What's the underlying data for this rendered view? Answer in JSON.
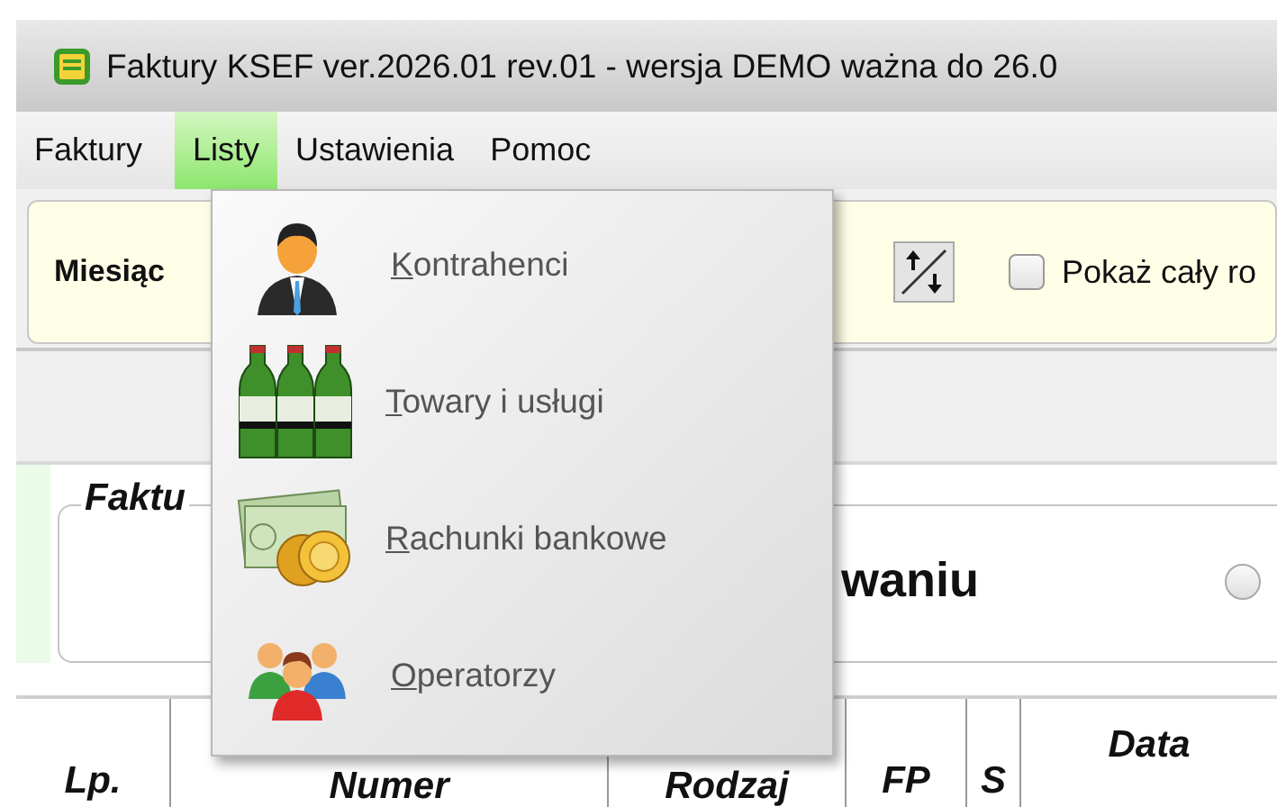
{
  "window": {
    "title": "Faktury KSEF ver.2026.01 rev.01 - wersja DEMO ważna do 26.0"
  },
  "menu_bar": [
    {
      "label": "Faktury",
      "selected": false
    },
    {
      "label": "Listy",
      "selected": true
    },
    {
      "label": "Ustawienia",
      "selected": false
    },
    {
      "label": "Pomoc",
      "selected": false
    }
  ],
  "dropdown": {
    "items": [
      {
        "label": "Kontrahenci",
        "kind": "person"
      },
      {
        "label": "Towary i usługi",
        "kind": "bottles"
      },
      {
        "label": "Rachunki bankowe",
        "kind": "money"
      },
      {
        "label": "Operatorzy",
        "kind": "group"
      }
    ]
  },
  "toolbar": {
    "month_label": "Miesiąc",
    "show_year": {
      "label": "Pokaż cały ro",
      "checked": false
    }
  },
  "invoice_group": {
    "title": "Faktu",
    "status_text": "waniu",
    "radio_selected": false
  },
  "table": {
    "columns": [
      "Lp.",
      "Numer",
      "Rodzaj",
      "FP",
      "S",
      "Data"
    ]
  }
}
